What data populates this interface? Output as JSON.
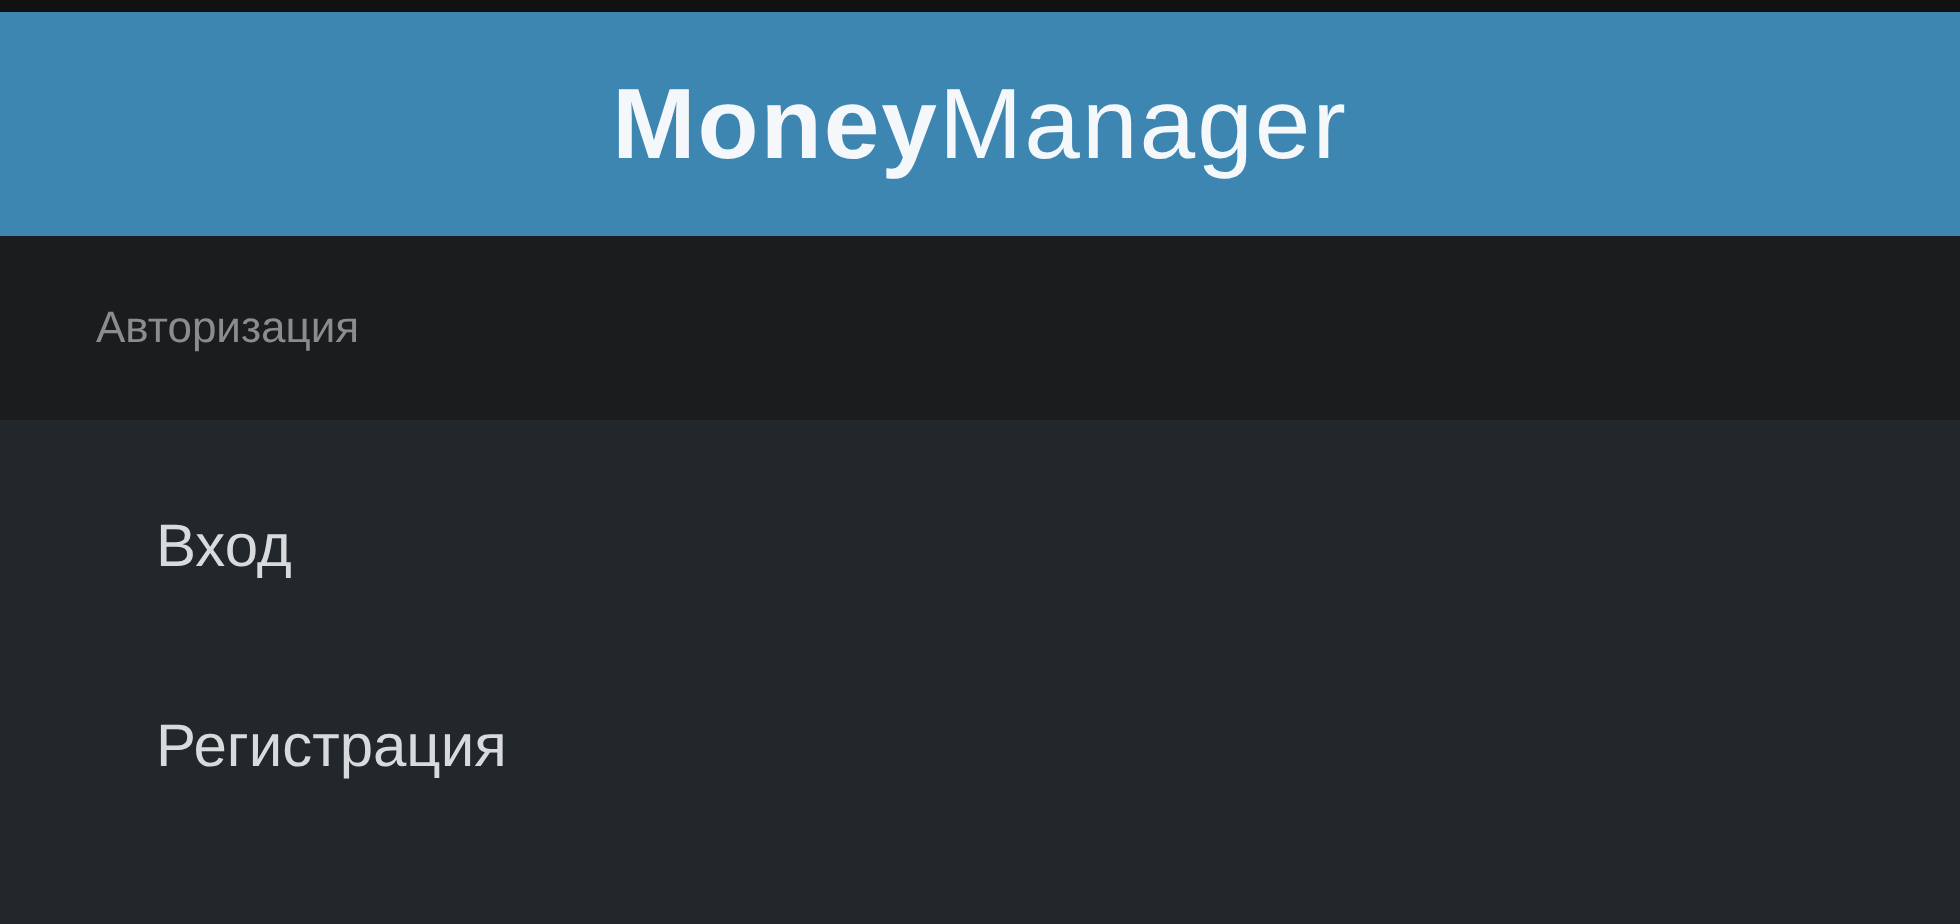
{
  "header": {
    "logo": "**Money**Manager"
  },
  "section": {
    "title": "Авторизация"
  },
  "menu": [
    {
      "label": "Вход"
    },
    {
      "label": "Регистрация"
    }
  ]
}
